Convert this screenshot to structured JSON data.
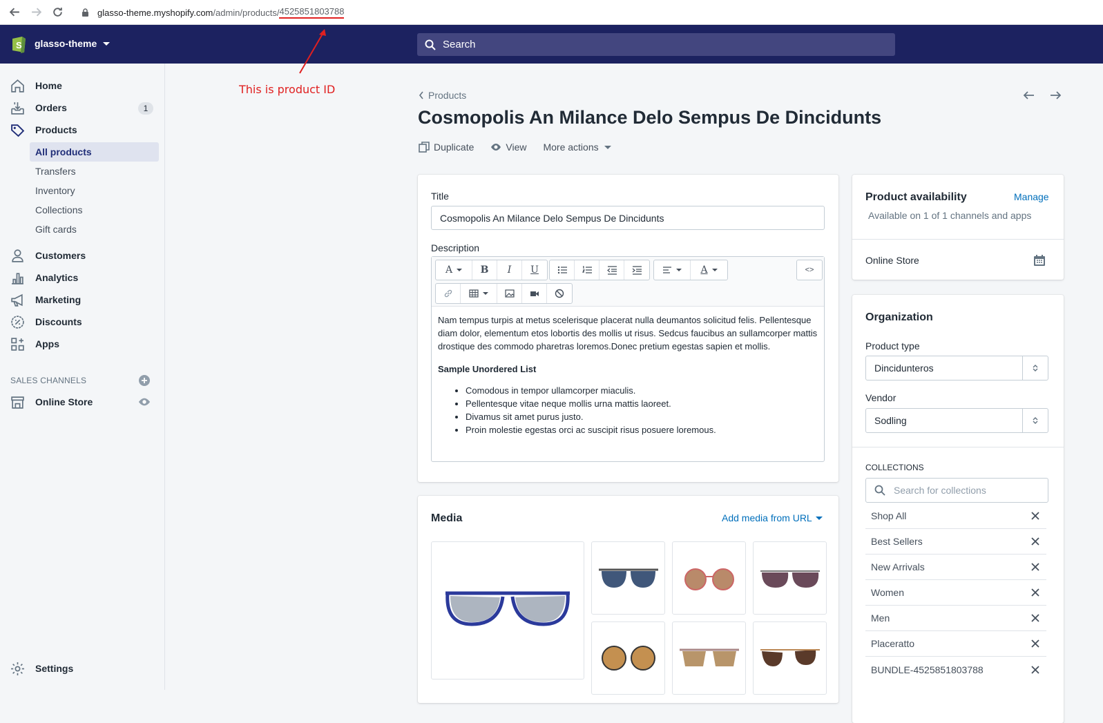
{
  "browser": {
    "url_host": "glasso-theme.myshopify.com",
    "url_path": "/admin/products/",
    "url_product_id": "4525851803788"
  },
  "annotation": {
    "text": "This is product ID",
    "color": "#e02020"
  },
  "topbar": {
    "store_name": "glasso-theme",
    "search_placeholder": "Search",
    "bg_color": "#1c2260"
  },
  "sidebar": {
    "items": [
      {
        "label": "Home",
        "icon": "home-icon"
      },
      {
        "label": "Orders",
        "icon": "orders-icon",
        "badge": "1"
      },
      {
        "label": "Products",
        "icon": "tag-icon"
      }
    ],
    "product_subitems": [
      "All products",
      "Transfers",
      "Inventory",
      "Collections",
      "Gift cards"
    ],
    "items2": [
      {
        "label": "Customers",
        "icon": "person-icon"
      },
      {
        "label": "Analytics",
        "icon": "bar-chart-icon"
      },
      {
        "label": "Marketing",
        "icon": "megaphone-icon"
      },
      {
        "label": "Discounts",
        "icon": "discount-icon"
      },
      {
        "label": "Apps",
        "icon": "apps-icon"
      }
    ],
    "sales_channels_title": "SALES CHANNELS",
    "online_store": "Online Store",
    "settings": "Settings"
  },
  "header": {
    "breadcrumb": "Products",
    "title": "Cosmopolis An Milance Delo Sempus De Dincidunts",
    "actions": [
      "Duplicate",
      "View",
      "More actions"
    ]
  },
  "main": {
    "title_label": "Title",
    "title_value": "Cosmopolis An Milance Delo Sempus De Dincidunts",
    "description_label": "Description",
    "description_paragraph": "Nam tempus turpis at metus scelerisque placerat nulla deumantos solicitud felis. Pellentesque diam dolor, elementum etos lobortis des mollis ut risus. Sedcus faucibus an sullamcorper mattis drostique des commodo pharetras loremos.Donec pretium egestas sapien et mollis.",
    "description_heading": "Sample Unordered List",
    "description_list": [
      "Comodous in tempor ullamcorper miaculis.",
      "Pellentesque vitae neque mollis urna mattis laoreet.",
      "Divamus sit amet purus justo.",
      "Proin molestie egestas orci ac suscipit risus posuere loremous."
    ],
    "code_button": "<>",
    "media_title": "Media",
    "add_media": "Add media from URL"
  },
  "availability": {
    "title": "Product availability",
    "manage": "Manage",
    "subtitle": "Available on 1 of 1 channels and apps",
    "channel": "Online Store"
  },
  "organization": {
    "title": "Organization",
    "product_type_label": "Product type",
    "product_type_value": "Dincidunteros",
    "vendor_label": "Vendor",
    "vendor_value": "Sodling",
    "collections_title": "COLLECTIONS",
    "collections_placeholder": "Search for collections",
    "collections": [
      "Shop All",
      "Best Sellers",
      "New Arrivals",
      "Women",
      "Men",
      "Placeratto",
      "BUNDLE-4525851803788"
    ]
  }
}
